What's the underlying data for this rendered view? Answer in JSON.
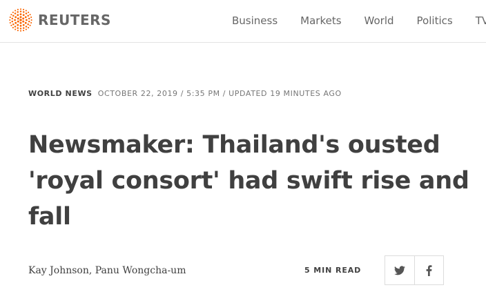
{
  "header": {
    "brand": "REUTERS",
    "brand_color": "#fa6400",
    "nav": [
      {
        "label": "Business"
      },
      {
        "label": "Markets"
      },
      {
        "label": "World"
      },
      {
        "label": "Politics"
      },
      {
        "label": "TV"
      }
    ]
  },
  "article": {
    "section": "WORLD NEWS",
    "dateline": "OCTOBER 22, 2019 / 5:35 PM / UPDATED 19 MINUTES AGO",
    "headline": "Newsmaker: Thailand's ousted 'royal consort' had swift rise and fall",
    "byline": "Kay Johnson, Panu Wongcha-um",
    "read_time": "5 MIN READ"
  },
  "share": {
    "icons": [
      "twitter-icon",
      "facebook-icon"
    ]
  },
  "colors": {
    "text_primary": "#404040",
    "text_secondary": "#767676",
    "nav_text": "#666666",
    "divider": "#e3e3e3"
  }
}
